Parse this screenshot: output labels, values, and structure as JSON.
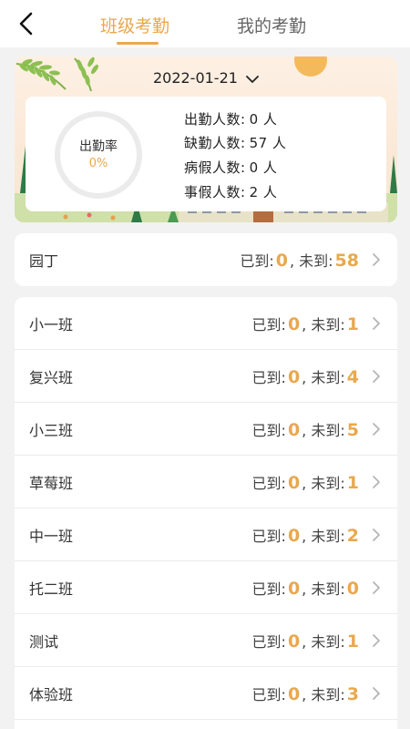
{
  "header": {
    "tabs": [
      {
        "label": "班级考勤",
        "active": true
      },
      {
        "label": "我的考勤",
        "active": false
      }
    ],
    "back_icon": "chevron-left-icon"
  },
  "summary": {
    "date": "2022-01-21",
    "rate_label": "出勤率",
    "rate_value": "0%",
    "stats": [
      {
        "label": "出勤人数:",
        "value": "0 人"
      },
      {
        "label": "缺勤人数:",
        "value": "57 人"
      },
      {
        "label": "病假人数:",
        "value": "0 人"
      },
      {
        "label": "事假人数:",
        "value": "2 人"
      }
    ]
  },
  "labels": {
    "arrived": "已到:",
    "sep": ",",
    "absent": "未到:"
  },
  "gardener": {
    "name": "园丁",
    "arrived": "0",
    "absent": "58"
  },
  "classes": [
    {
      "name": "小一班",
      "arrived": "0",
      "absent": "1"
    },
    {
      "name": "复兴班",
      "arrived": "0",
      "absent": "4"
    },
    {
      "name": "小三班",
      "arrived": "0",
      "absent": "5"
    },
    {
      "name": "草莓班",
      "arrived": "0",
      "absent": "1"
    },
    {
      "name": "中一班",
      "arrived": "0",
      "absent": "2"
    },
    {
      "name": "托二班",
      "arrived": "0",
      "absent": "0"
    },
    {
      "name": "测试",
      "arrived": "0",
      "absent": "1"
    },
    {
      "name": "体验班",
      "arrived": "0",
      "absent": "3"
    }
  ],
  "colors": {
    "accent": "#e9a84d",
    "background": "#f2f2f2"
  }
}
